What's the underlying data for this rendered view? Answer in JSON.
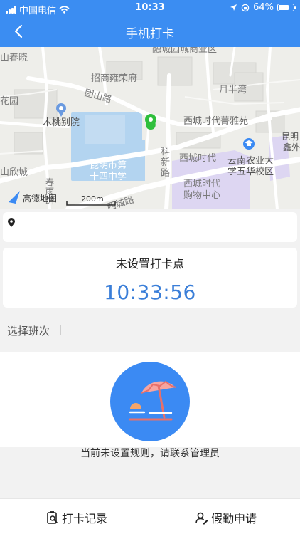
{
  "status_bar": {
    "carrier": "中国电信",
    "time": "10:33",
    "battery_percent": "64%",
    "battery_level": 0.64,
    "icons": [
      "signal-icon",
      "wifi-icon",
      "location-arrow-icon",
      "orientation-lock-icon",
      "battery-icon"
    ]
  },
  "header": {
    "title": "手机打卡",
    "back_icon": "chevron-left-icon"
  },
  "map": {
    "labels": {
      "chunxiao": "山春晓",
      "business_area": "融城园城商业区",
      "zhaoshang": "招商雍荣府",
      "tuanshan_road": "团山路",
      "yuebanwan": "月半湾",
      "huayuan": "花园",
      "mutao": "木桃别院",
      "xicheng_jingya": "西城时代菁雅苑",
      "kunming_xin": "昆明",
      "kunming_xin2": "鑫外",
      "kexin_1": "科",
      "kexin_2": "新",
      "kexin_3": "路",
      "xicheng_shidai": "西城时代",
      "nongye_1": "云南农业大",
      "nongye_2": "学五华校区",
      "school_1": "昆明市第",
      "school_2": "十四中学",
      "shanxin": "山欣城",
      "chunyu_1": "春",
      "chunyu_2": "雨",
      "chunyu_3": "路",
      "xicheng_mall_1": "西城时代",
      "xicheng_mall_2": "购物中心",
      "xicheng_road": "西城路",
      "amap_logo": "高德地图",
      "scale": "200m"
    }
  },
  "address": {
    "pin_icon": "location-pin-icon",
    "text": ""
  },
  "clock": {
    "status_label": "未设置打卡点",
    "current_time": "10:33:56"
  },
  "shift": {
    "label": "选择班次"
  },
  "empty_state": {
    "illustration": "beach-umbrella-icon",
    "message": "当前未设置规则，请联系管理员"
  },
  "tabbar": {
    "record_label": "打卡记录",
    "record_icon": "clipboard-search-icon",
    "leave_label": "假勤申请",
    "leave_icon": "person-edit-icon"
  },
  "colors": {
    "primary": "#3b8df2",
    "time_text": "#3a7ed8",
    "location_marker": "#2fbf3c",
    "map_water": "#b3d4f0",
    "map_district": "#ddd6f2"
  }
}
